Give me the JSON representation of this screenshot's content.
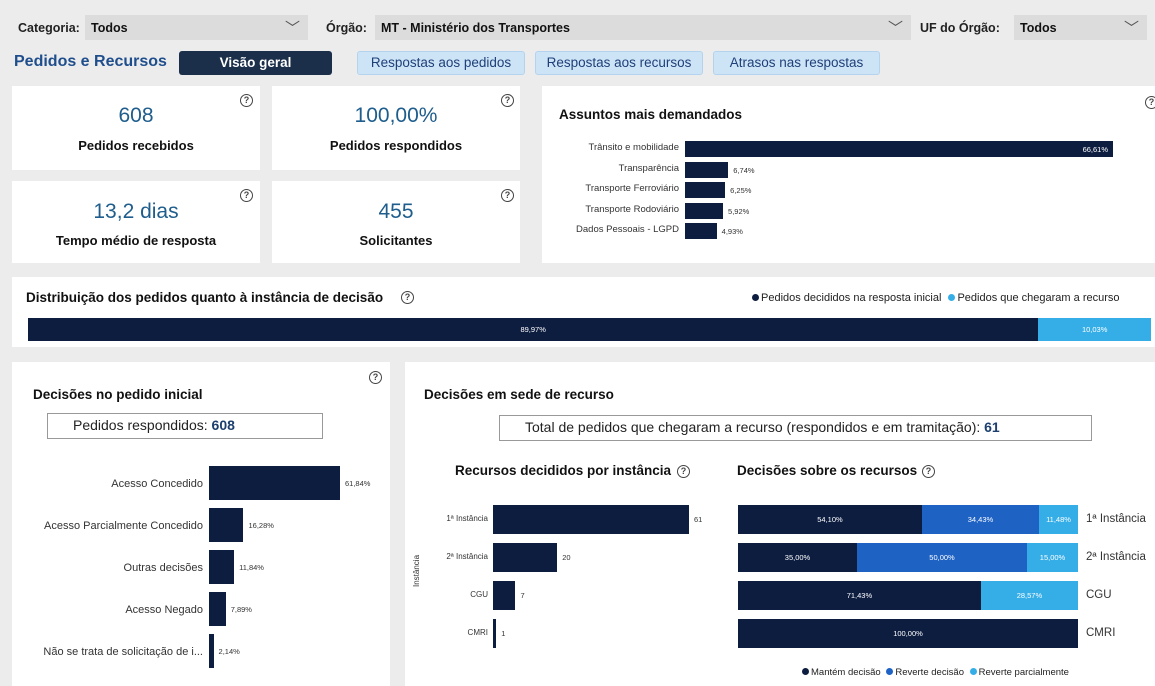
{
  "filters": {
    "categoria": {
      "label": "Categoria:",
      "value": "Todos"
    },
    "orgao": {
      "label": "Órgão:",
      "value": "MT - Ministério dos Transportes"
    },
    "uf": {
      "label": "UF do Órgão:",
      "value": "Todos"
    }
  },
  "nav": {
    "title": "Pedidos e Recursos",
    "tabs": [
      {
        "label": "Visão geral",
        "active": true
      },
      {
        "label": "Respostas aos pedidos",
        "active": false
      },
      {
        "label": "Respostas aos recursos",
        "active": false
      },
      {
        "label": "Atrasos nas respostas",
        "active": false
      }
    ]
  },
  "kpis": {
    "pedidos_recebidos": {
      "value": "608",
      "label": "Pedidos recebidos"
    },
    "pedidos_respondidos": {
      "value": "100,00%",
      "label": "Pedidos respondidos"
    },
    "tempo_medio": {
      "value": "13,2 dias",
      "label": "Tempo médio de resposta"
    },
    "solicitantes": {
      "value": "455",
      "label": "Solicitantes"
    }
  },
  "help_glyph": "?",
  "assuntos": {
    "title": "Assuntos mais demandados",
    "items": [
      {
        "label": "Trânsito e mobilidade",
        "value": "66,61%",
        "pct": 66.61
      },
      {
        "label": "Transparência",
        "value": "6,74%",
        "pct": 6.74
      },
      {
        "label": "Transporte Ferroviário",
        "value": "6,25%",
        "pct": 6.25
      },
      {
        "label": "Transporte Rodoviário",
        "value": "5,92%",
        "pct": 5.92
      },
      {
        "label": "Dados Pessoais - LGPD",
        "value": "4,93%",
        "pct": 4.93
      }
    ]
  },
  "distribuicao": {
    "title": "Distribuição dos pedidos quanto à instância de decisão",
    "legend": [
      "Pedidos decididos na resposta inicial",
      "Pedidos que chegaram a recurso"
    ],
    "values": [
      {
        "value": "89,97%",
        "pct": 89.97
      },
      {
        "value": "10,03%",
        "pct": 10.03
      }
    ]
  },
  "decisoes_inicial": {
    "title": "Decisões no pedido inicial",
    "box_label": "Pedidos respondidos:",
    "box_value": "608",
    "items": [
      {
        "label": "Acesso Concedido",
        "value": "61,84%",
        "pct": 61.84
      },
      {
        "label": "Acesso Parcialmente Concedido",
        "value": "16,28%",
        "pct": 16.28
      },
      {
        "label": "Outras decisões",
        "value": "11,84%",
        "pct": 11.84
      },
      {
        "label": "Acesso Negado",
        "value": "7,89%",
        "pct": 7.89
      },
      {
        "label": "Não se trata de solicitação de i...",
        "value": "2,14%",
        "pct": 2.14
      }
    ]
  },
  "recurso": {
    "title": "Decisões em sede de recurso",
    "box_label": "Total de pedidos que chegaram a recurso (respondidos e em tramitação):",
    "box_value": "61",
    "instancia": {
      "title": "Recursos decididos por instância",
      "axis_label": "Instância",
      "items": [
        {
          "label": "1ª Instância",
          "value": 61
        },
        {
          "label": "2ª Instância",
          "value": 20
        },
        {
          "label": "CGU",
          "value": 7
        },
        {
          "label": "CMRI",
          "value": 1
        }
      ]
    },
    "decisoes": {
      "title": "Decisões sobre os recursos",
      "legend": [
        "Mantém decisão",
        "Reverte decisão",
        "Reverte parcialmente"
      ],
      "rows": [
        {
          "label": "1ª Instância",
          "segs": [
            {
              "v": "54,10%",
              "p": 54.1
            },
            {
              "v": "34,43%",
              "p": 34.43
            },
            {
              "v": "11,48%",
              "p": 11.48
            }
          ]
        },
        {
          "label": "2ª Instância",
          "segs": [
            {
              "v": "35,00%",
              "p": 35.0
            },
            {
              "v": "50,00%",
              "p": 50.0
            },
            {
              "v": "15,00%",
              "p": 15.0
            }
          ]
        },
        {
          "label": "CGU",
          "segs": [
            {
              "v": "71,43%",
              "p": 71.43
            },
            {
              "v": "28,57%",
              "p": 28.57
            }
          ]
        },
        {
          "label": "CMRI",
          "segs": [
            {
              "v": "100,00%",
              "p": 100.0
            }
          ]
        }
      ]
    }
  },
  "colors": {
    "dark": "#0d1d40",
    "mid": "#1e62c4",
    "light": "#35aee8",
    "accent": "#1e5d8c"
  }
}
